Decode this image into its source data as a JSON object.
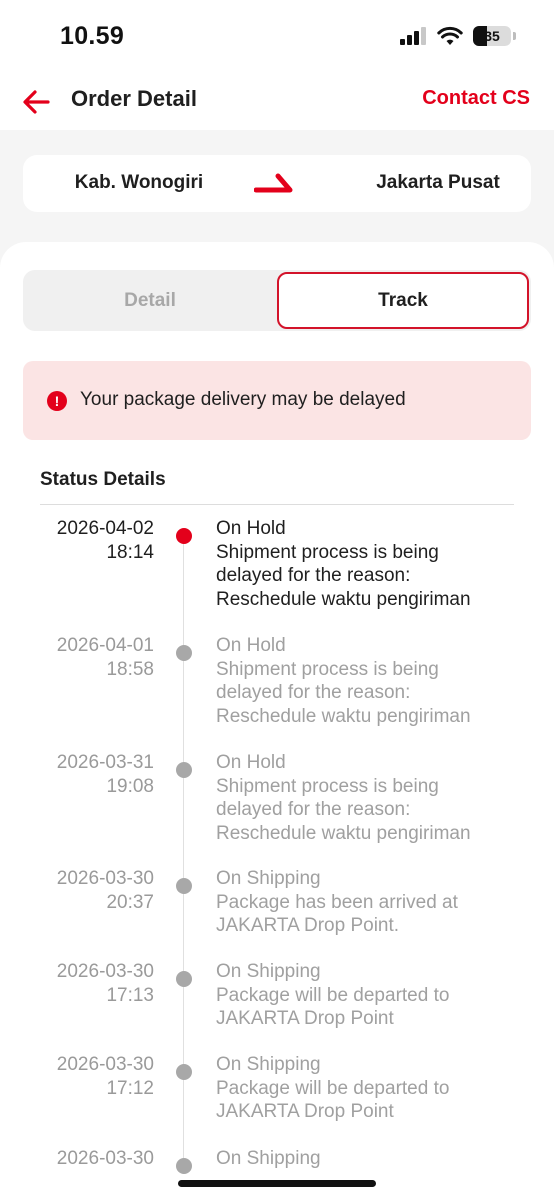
{
  "status_bar": {
    "time": "10.59",
    "battery": "35"
  },
  "nav": {
    "title": "Order Detail",
    "contact": "Contact CS"
  },
  "route": {
    "from": "Kab. Wonogiri",
    "to": "Jakarta Pusat",
    "accent": "#e3001b"
  },
  "tabs": {
    "detail": "Detail",
    "track": "Track",
    "selected": "Track"
  },
  "alert": {
    "text": "Your package delivery may be delayed",
    "icon": "alert-circle-icon"
  },
  "status_details": {
    "heading": "Status Details",
    "events": [
      {
        "date": "2026-04-02",
        "time": "18:14",
        "status": "On Hold",
        "desc1": "Shipment process is being",
        "desc2": "delayed for the reason:",
        "desc3": "Reschedule waktu pengiriman"
      },
      {
        "date": "2026-04-01",
        "time": "18:58",
        "status": "On Hold",
        "desc1": "Shipment process is being",
        "desc2": "delayed for the reason:",
        "desc3": "Reschedule waktu pengiriman"
      },
      {
        "date": "2026-03-31",
        "time": "19:08",
        "status": "On Hold",
        "desc1": "Shipment process is being",
        "desc2": "delayed for the reason:",
        "desc3": "Reschedule waktu pengiriman"
      },
      {
        "date": "2026-03-30",
        "time": "20:37",
        "status": "On Shipping",
        "desc1": "Package has been arrived at",
        "desc2": "JAKARTA Drop Point."
      },
      {
        "date": "2026-03-30",
        "time": "17:13",
        "status": "On Shipping",
        "desc1": "Package will be departed to",
        "desc2": "JAKARTA Drop Point"
      },
      {
        "date": "2026-03-30",
        "time": "17:12",
        "status": "On Shipping",
        "desc1": "Package will be departed to",
        "desc2": "JAKARTA Drop Point"
      },
      {
        "date": "2026-03-30",
        "status": "On Shipping"
      }
    ]
  }
}
